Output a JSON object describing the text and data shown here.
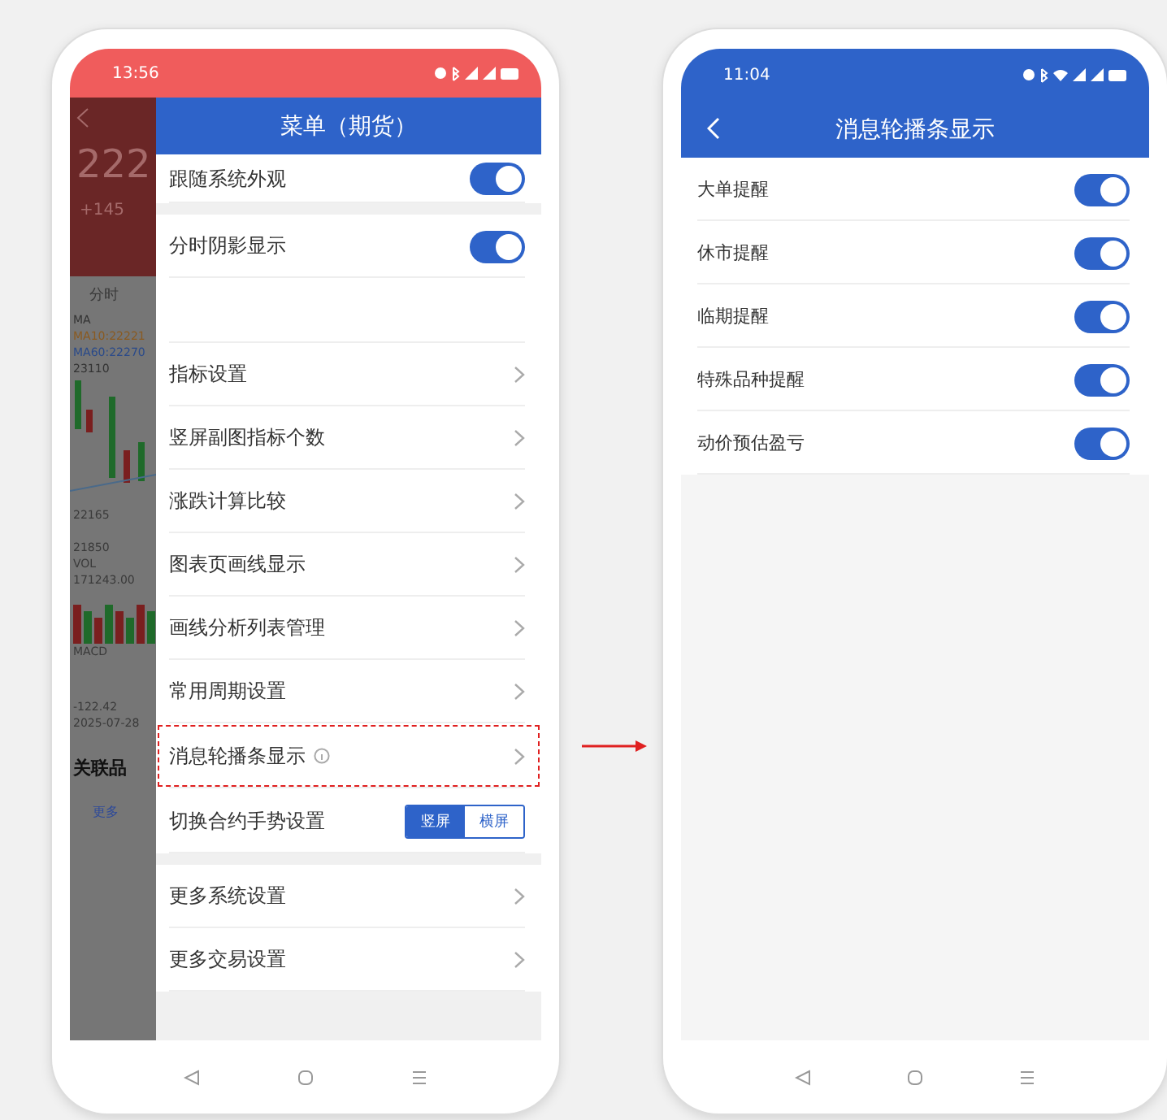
{
  "left_phone": {
    "status_bar": {
      "time": "13:56"
    },
    "background_chart": {
      "price": "222",
      "change": "+145",
      "tab": "分时",
      "labels": [
        "MA",
        "MA10:22221",
        "MA60:22270",
        "23110"
      ],
      "levels": [
        "22165",
        "21850"
      ],
      "volume_labels": [
        "VOL",
        "171243.00"
      ],
      "macd_labels": [
        "MACD",
        "-122.42",
        "2025-07-28"
      ],
      "section": "关联品",
      "more": "更多"
    },
    "drawer": {
      "title": "菜单（期货）",
      "groups": [
        [
          {
            "kind": "toggle",
            "label": "跟随系统外观",
            "on": true,
            "highlighted": false
          }
        ],
        [
          {
            "kind": "toggle",
            "label": "分时阴影显示",
            "on": true,
            "highlighted": false
          },
          {
            "kind": "blank",
            "highlighted": false
          },
          {
            "kind": "link",
            "label": "指标设置",
            "highlighted": false
          },
          {
            "kind": "link",
            "label": "竖屏副图指标个数",
            "highlighted": false
          },
          {
            "kind": "link",
            "label": "涨跌计算比较",
            "highlighted": false
          },
          {
            "kind": "link",
            "label": "图表页画线显示",
            "highlighted": false
          },
          {
            "kind": "link",
            "label": "画线分析列表管理",
            "highlighted": false
          },
          {
            "kind": "link",
            "label": "常用周期设置",
            "highlighted": false
          },
          {
            "kind": "link",
            "label": "消息轮播条显示",
            "info": true,
            "highlighted": true
          },
          {
            "kind": "segmented",
            "label": "切换合约手势设置",
            "options": [
              {
                "label": "竖屏",
                "selected": true
              },
              {
                "label": "横屏",
                "selected": false
              }
            ],
            "highlighted": false
          }
        ],
        [
          {
            "kind": "link",
            "label": "更多系统设置",
            "highlighted": false
          },
          {
            "kind": "link",
            "label": "更多交易设置",
            "highlighted": false
          }
        ]
      ]
    }
  },
  "right_phone": {
    "status_bar": {
      "time": "11:04"
    },
    "title": "消息轮播条显示",
    "rows": [
      {
        "label": "大单提醒",
        "on": true
      },
      {
        "label": "休市提醒",
        "on": true
      },
      {
        "label": "临期提醒",
        "on": true
      },
      {
        "label": "特殊品种提醒",
        "on": true
      },
      {
        "label": "动价预估盈亏",
        "on": true
      }
    ]
  }
}
